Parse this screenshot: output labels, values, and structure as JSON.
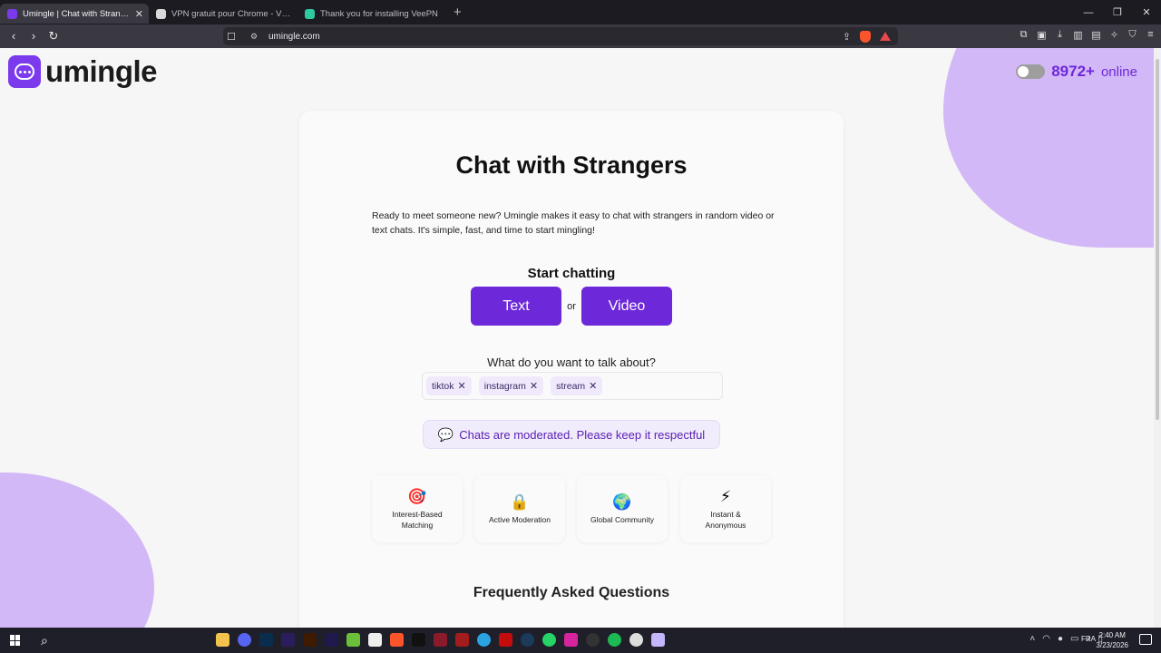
{
  "browser": {
    "tabs": [
      {
        "title": "Umingle | Chat with Strangers",
        "active": true,
        "favicon_color": "#7c3aed"
      },
      {
        "title": "VPN gratuit pour Chrome - VPN Pro",
        "active": false,
        "favicon_color": "#d9d9d9"
      },
      {
        "title": "Thank you for installing VeePN",
        "active": false,
        "favicon_color": "#2fc9a0"
      }
    ],
    "close_tab": "✕",
    "new_tab": "+",
    "url": "umingle.com",
    "window_controls": [
      "—",
      "❐",
      "✕"
    ]
  },
  "page": {
    "logo_text": "umingle",
    "online_count": "8972+",
    "online_label": "online",
    "heading": "Chat with Strangers",
    "intro": "Ready to meet someone new? Umingle makes it easy to chat with strangers in random video or text chats. It's simple, fast, and time to start mingling!",
    "start_label": "Start chatting",
    "text_button": "Text",
    "or_label": "or",
    "video_button": "Video",
    "topics_label": "What do you want to talk about?",
    "tags": [
      "tiktok",
      "instagram",
      "stream"
    ],
    "tag_remove": "✕",
    "moderation_note": "Chats are moderated. Please keep it respectful",
    "features": [
      {
        "icon": "target-icon",
        "glyph": "🎯",
        "label": "Interest-Based Matching"
      },
      {
        "icon": "lock-icon",
        "glyph": "🔒",
        "label": "Active Moderation"
      },
      {
        "icon": "globe-icon",
        "glyph": "🌍",
        "label": "Global Community"
      },
      {
        "icon": "lightning-icon",
        "glyph": "⚡",
        "label": "Instant & Anonymous"
      }
    ],
    "faq_heading": "Frequently Asked Questions"
  },
  "taskbar": {
    "language": "FRA",
    "time": "2:40 AM",
    "date": "3/23/2026"
  },
  "colors": {
    "brand_purple": "#6d28d9",
    "accent_lilac": "#d3b8f7",
    "sparkle_pink": "#f4a3c6"
  }
}
